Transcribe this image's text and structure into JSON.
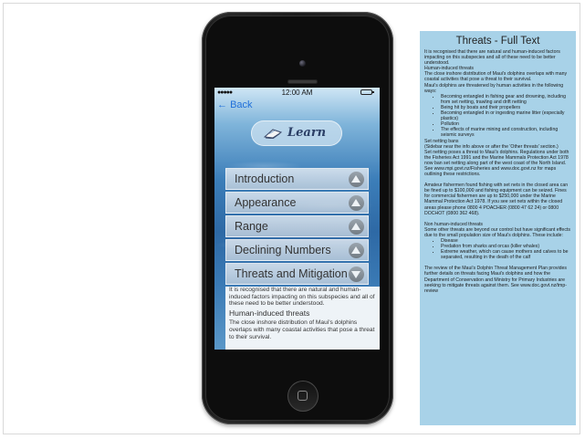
{
  "status_bar": {
    "signal": "●●●●●",
    "time": "12:00 AM"
  },
  "nav": {
    "back_label": "Back"
  },
  "header": {
    "title": "Learn"
  },
  "menu": [
    {
      "label": "Introduction",
      "expanded": false
    },
    {
      "label": "Appearance",
      "expanded": false
    },
    {
      "label": "Range",
      "expanded": false
    },
    {
      "label": "Declining Numbers",
      "expanded": false
    },
    {
      "label": "Threats and Mitigation",
      "expanded": true
    }
  ],
  "expanded_content": {
    "intro": "It is recognised that there are natural and human-induced factors impacting on this subspecies and all of these need to be better understood.",
    "heading": "Human-induced threats",
    "body": "The close inshore distribution of Maui's dolphins overlaps with many coastal activities that pose a threat to their survival."
  },
  "full_text": {
    "title": "Threats - Full Text",
    "intro": "It is recognised that there are natural and human-induced factors impacting on this subspecies and all of these need to be better understood.",
    "h1": "Human-induced threats",
    "p1": "The close inshore distribution of Maui's dolphins overlaps with many coastal activities that pose a threat to their survival.",
    "p2": "Maui's dolphins are threatened by human activities in the following ways:",
    "bullets1": [
      "Becoming entangled in fishing gear and drowning, including from set netting, trawling and drift netting",
      "Being hit by boats and their propellers",
      "Becoming entangled in or ingesting marine litter (especially plastics)",
      "Pollution",
      "The effects of marine mining and construction, including seismic surveys"
    ],
    "h2": "Set netting bans",
    "note": "(Sidebar near the info above or after the 'Other threats' section.)",
    "p3": "Set netting poses a threat to Maui's dolphins. Regulations under both the Fisheries Act 1991 and the Marine Mammals Protection Act 1978 now ban set netting along part of the west coast of the North Island.",
    "p4": "See www.mpi.govt.nz/Fisheries and www.doc.govt.nz for maps outlining these restrictions.",
    "p5": "Amateur fishermen found fishing with set nets in the closed area can be fined up to $100,000 and fishing equipment can be seized. Fines for commercial fishermen are up to $250,000 under the Marine Mammal Protection Act 1978. If you see set nets within the closed areas please phone 0800 4 POACHER (0800 47 62 24) or 0800 DOCHOT (0800 362 468).",
    "h3": "Non human-induced threats",
    "p6": "Some other threats are beyond our control but have significant effects due to the small population size of Maui's dolphins. These include:",
    "bullets2": [
      "Disease",
      "Predation from sharks and orcas (killer whales)",
      "Extreme weather, which can cause mothers and calves to be separated, resulting in the death of the calf"
    ],
    "p7": "The review of the Maui's Dolphin Threat Management Plan provides further details on threats facing Maui's dolphins and how the Department of Conservation and Ministry for Primary Industries are seeking to mitigate threats against them. See www.doc.govt.nz/tmp-review"
  }
}
